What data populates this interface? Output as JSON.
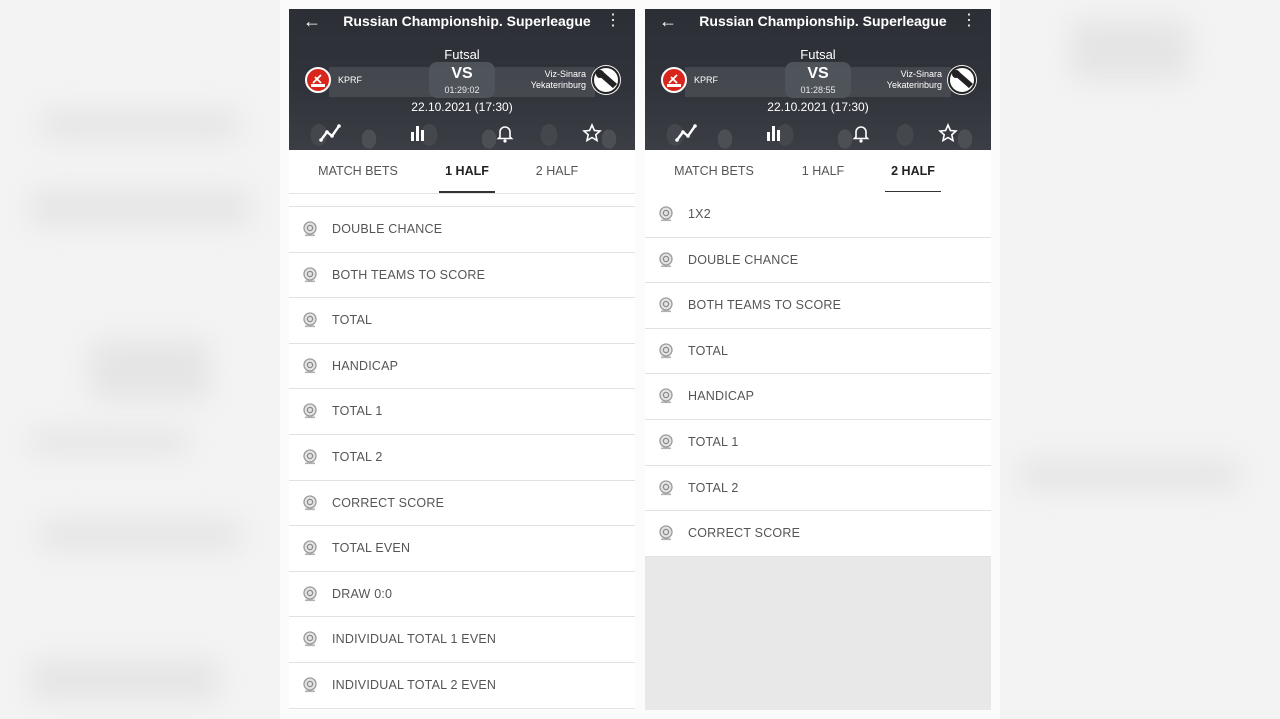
{
  "screens": [
    {
      "title": "Russian Championship. Superleague",
      "sport": "Futsal",
      "team1": "KPRF",
      "team2_line1": "Viz-Sinara",
      "team2_line2": "Yekaterinburg",
      "vs": "VS",
      "timer": "01:29:02",
      "date": "22.10.2021 (17:30)",
      "tabs": [
        "MATCH BETS",
        "1 HALF",
        "2 HALF"
      ],
      "active_tab": "1 HALF",
      "markets": [
        "DOUBLE CHANCE",
        "BOTH TEAMS TO SCORE",
        "TOTAL",
        "HANDICAP",
        "TOTAL 1",
        "TOTAL 2",
        "CORRECT SCORE",
        "TOTAL EVEN",
        "DRAW 0:0",
        "INDIVIDUAL TOTAL 1 EVEN",
        "INDIVIDUAL TOTAL 2 EVEN"
      ]
    },
    {
      "title": "Russian Championship. Superleague",
      "sport": "Futsal",
      "team1": "KPRF",
      "team2_line1": "Viz-Sinara",
      "team2_line2": "Yekaterinburg",
      "vs": "VS",
      "timer": "01:28:55",
      "date": "22.10.2021 (17:30)",
      "tabs": [
        "MATCH BETS",
        "1 HALF",
        "2 HALF"
      ],
      "active_tab": "2 HALF",
      "markets": [
        "1X2",
        "DOUBLE CHANCE",
        "BOTH TEAMS TO SCORE",
        "TOTAL",
        "HANDICAP",
        "TOTAL 1",
        "TOTAL 2",
        "CORRECT SCORE"
      ]
    }
  ],
  "icons": {
    "back": "arrow-left-icon",
    "menu": "more-vertical-icon",
    "stats_line": "line-chart-icon",
    "stats_bar": "bar-chart-icon",
    "notify": "bell-icon",
    "favorite": "star-icon",
    "market": "market-pin-icon"
  },
  "colors": {
    "header_bg": "#30343a",
    "team1_logo": "#d9261c",
    "active_tab_underline": "#333333"
  }
}
